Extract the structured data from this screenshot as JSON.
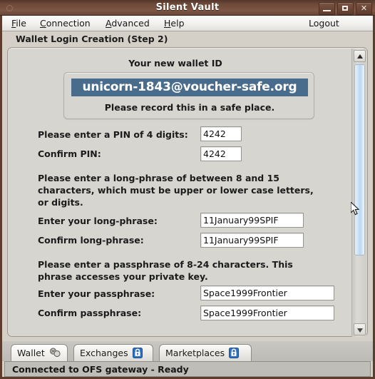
{
  "window": {
    "title": "Silent Vault",
    "buttons": {
      "minimize": "–",
      "maximize": "□",
      "close": "✕"
    }
  },
  "menubar": {
    "items": [
      {
        "label": "File",
        "mnemonic": "F"
      },
      {
        "label": "Connection",
        "mnemonic": "C"
      },
      {
        "label": "Advanced",
        "mnemonic": "A"
      },
      {
        "label": "Help",
        "mnemonic": "H"
      }
    ],
    "logout_label": "Logout"
  },
  "page": {
    "heading": "Wallet Login Creation (Step 2)"
  },
  "wallet_id": {
    "title": "Your new wallet ID",
    "value": "unicorn-1843@voucher-safe.org",
    "note": "Please record this in a safe place.",
    "highlight_color": "#4a6c8c"
  },
  "form": {
    "pin": {
      "label": "Please enter a PIN of 4 digits:",
      "value": "4242",
      "confirm_label": "Confirm PIN:",
      "confirm_value": "4242"
    },
    "longphrase": {
      "instructions": "Please enter a long-phrase of between 8 and 15 characters, which must be upper or lower case letters, or digits.",
      "label": "Enter your long-phrase:",
      "value": "11January99SPIF",
      "confirm_label": "Confirm long-phrase:",
      "confirm_value": "11January99SPIF"
    },
    "passphrase": {
      "instructions": "Please enter a passphrase of 8-24 characters.  This phrase accesses your private key.",
      "label": "Enter your passphrase:",
      "value": "Space1999Frontier",
      "confirm_label": "Confirm passphrase:",
      "confirm_value": "Space1999Frontier"
    }
  },
  "tabs": [
    {
      "label": "Wallet",
      "icon": "wallet-icon",
      "selected": true
    },
    {
      "label": "Exchanges",
      "icon": "lock-icon",
      "selected": false
    },
    {
      "label": "Marketplaces",
      "icon": "lock-icon",
      "selected": false
    }
  ],
  "statusbar": {
    "text": "Connected to OFS gateway - Ready"
  }
}
